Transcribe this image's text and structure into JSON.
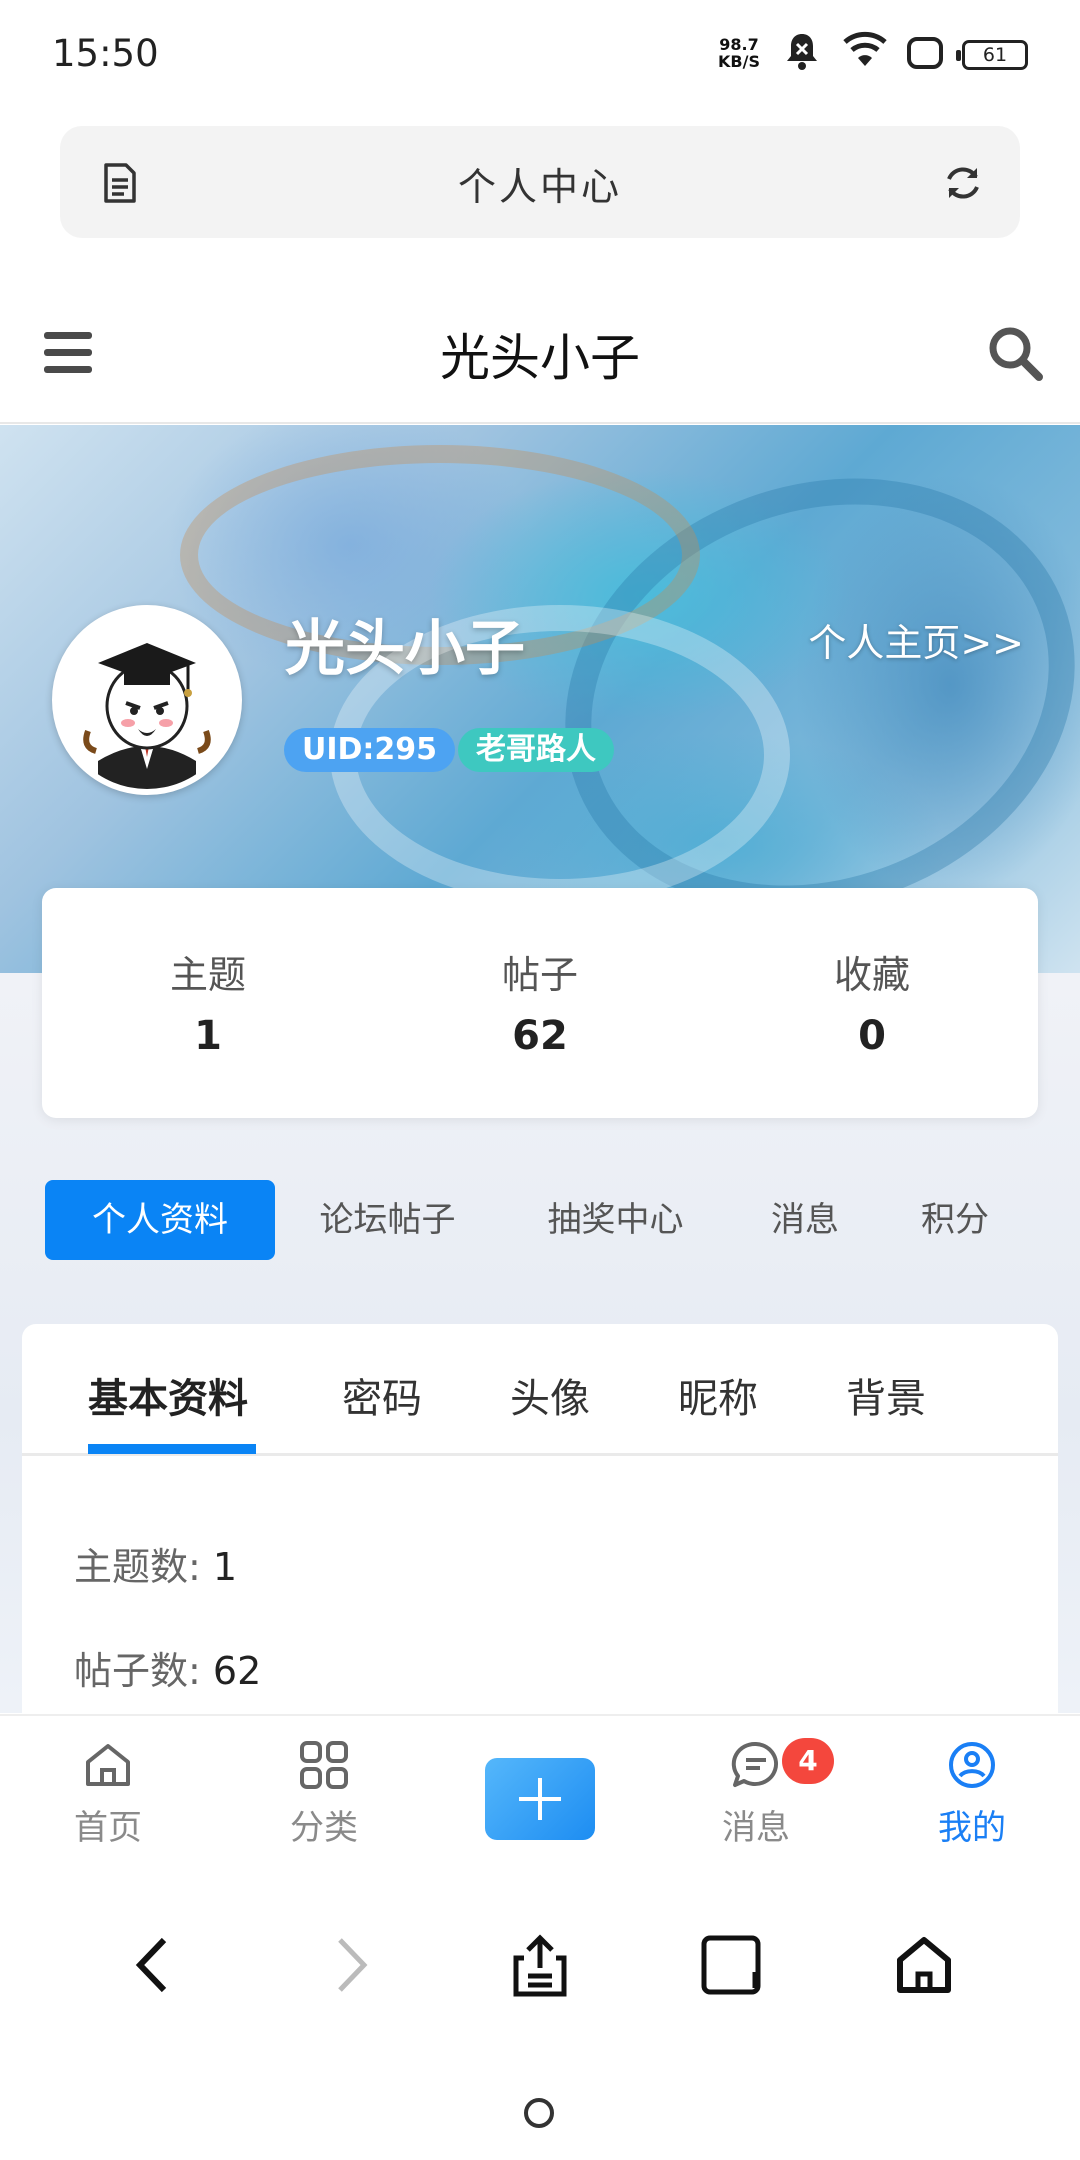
{
  "status": {
    "time": "15:50",
    "net_speed_value": "98.7",
    "net_speed_unit": "KB/S",
    "battery": "61",
    "icons": [
      "mute-bell-icon",
      "wifi-icon",
      "screen-icon",
      "battery-icon"
    ]
  },
  "urlbar": {
    "title": "个人中心",
    "left_icon": "document-icon",
    "right_icon": "reload-icon"
  },
  "header": {
    "title": "光头小子",
    "menu_icon": "menu-icon",
    "search_icon": "search-icon"
  },
  "profile": {
    "name": "光头小子",
    "home_link": "个人主页>>",
    "uid": "UID:295",
    "rank": "老哥路人"
  },
  "stats": [
    {
      "label": "主题",
      "value": "1"
    },
    {
      "label": "帖子",
      "value": "62"
    },
    {
      "label": "收藏",
      "value": "0"
    }
  ],
  "nav_tabs": [
    "个人资料",
    "论坛帖子",
    "抽奖中心",
    "消息",
    "积分"
  ],
  "sub_tabs": [
    "基本资料",
    "密码",
    "头像",
    "昵称",
    "背景"
  ],
  "fields": [
    {
      "label": "主题数:",
      "value": "1"
    },
    {
      "label": "帖子数:",
      "value": "62"
    }
  ],
  "bottom_nav": {
    "home": "首页",
    "category": "分类",
    "messages": "消息",
    "messages_badge": "4",
    "mine": "我的"
  },
  "colors": {
    "accent": "#0a84f5",
    "badge": "#f4473d",
    "uid_pill": "#4da3f2",
    "rank_pill": "#3ec8c0"
  }
}
